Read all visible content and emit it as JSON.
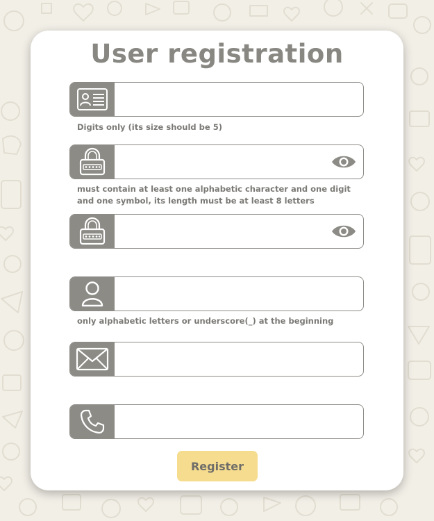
{
  "page": {
    "title": "User registration"
  },
  "fields": {
    "id": {
      "value": "",
      "placeholder": "",
      "hint": "Digits only (its size should be 5)",
      "icon": "id-card-icon"
    },
    "password": {
      "value": "",
      "placeholder": "",
      "hint": "must contain at least one alphabetic character and one digit and one symbol, its length must be at least 8 letters",
      "icon": "padlock-icon"
    },
    "confirm_password": {
      "value": "",
      "placeholder": "",
      "icon": "padlock-icon"
    },
    "username": {
      "value": "",
      "placeholder": "",
      "hint": "only alphabetic letters or underscore(_) at the beginning",
      "icon": "user-icon"
    },
    "email": {
      "value": "",
      "placeholder": "",
      "icon": "envelope-icon"
    },
    "phone": {
      "value": "",
      "placeholder": "",
      "icon": "phone-icon"
    }
  },
  "actions": {
    "register_label": "Register"
  },
  "colors": {
    "background": "#f2efe7",
    "card": "#ffffff",
    "icon_box": "#8c8b86",
    "title": "#888782",
    "button": "#f6dc8e",
    "button_text": "#6e6d69"
  }
}
